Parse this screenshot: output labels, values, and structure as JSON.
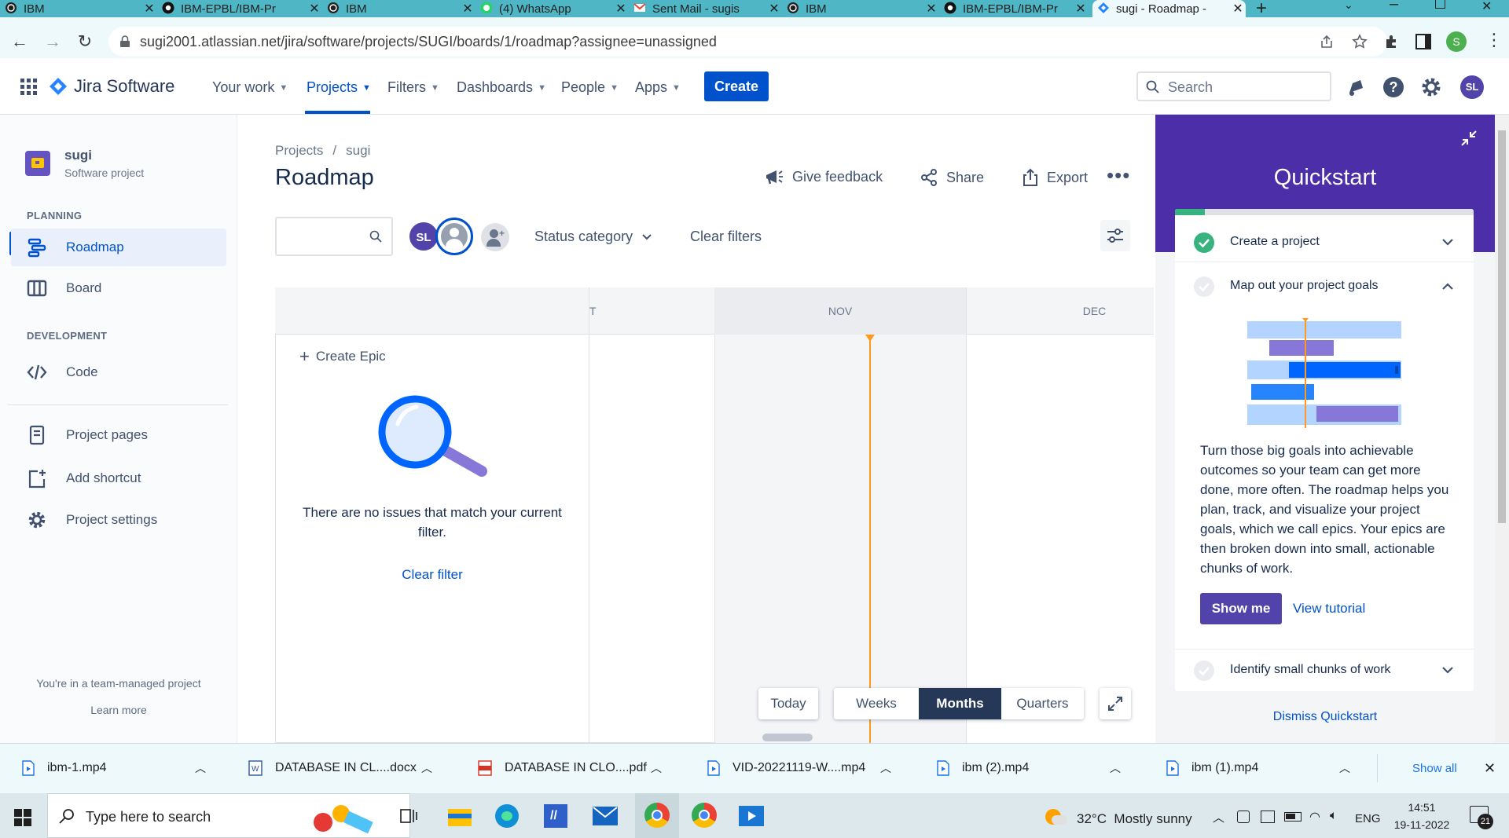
{
  "browser": {
    "tabs": [
      {
        "label": "IBM",
        "icon": "globe-icon"
      },
      {
        "label": "IBM-EPBL/IBM-Pr",
        "icon": "github-icon"
      },
      {
        "label": "IBM",
        "icon": "globe-icon"
      },
      {
        "label": "(4) WhatsApp",
        "icon": "whatsapp-icon"
      },
      {
        "label": "Sent Mail - sugis",
        "icon": "gmail-icon"
      },
      {
        "label": "IBM",
        "icon": "globe-icon"
      },
      {
        "label": "IBM-EPBL/IBM-Pr",
        "icon": "github-icon"
      },
      {
        "label": "sugi - Roadmap -",
        "icon": "jira-icon"
      }
    ],
    "url": "sugi2001.atlassian.net/jira/software/projects/SUGI/boards/1/roadmap?assignee=unassigned",
    "profile_initial": "S"
  },
  "header": {
    "product": "Jira Software",
    "nav": [
      "Your work",
      "Projects",
      "Filters",
      "Dashboards",
      "People",
      "Apps"
    ],
    "create_label": "Create",
    "search_placeholder": "Search",
    "avatar_initials": "SL"
  },
  "sidebar": {
    "project_name": "sugi",
    "project_type": "Software project",
    "planning_heading": "PLANNING",
    "development_heading": "DEVELOPMENT",
    "items": {
      "roadmap": "Roadmap",
      "board": "Board",
      "code": "Code",
      "project_pages": "Project pages",
      "add_shortcut": "Add shortcut",
      "project_settings": "Project settings"
    },
    "footer_text": "You're in a team-managed project",
    "learn_more": "Learn more"
  },
  "main": {
    "breadcrumb": {
      "projects": "Projects",
      "separator": "/",
      "project": "sugi"
    },
    "title": "Roadmap",
    "actions": {
      "feedback": "Give feedback",
      "share": "Share",
      "export": "Export"
    },
    "filter": {
      "avatar_initials": "SL",
      "status_category": "Status category",
      "clear_filters": "Clear filters"
    },
    "timeline": {
      "months": [
        "T",
        "NOV",
        "DEC"
      ],
      "create_epic": "Create Epic",
      "empty_message": "There are no issues that match your current filter.",
      "clear_filter": "Clear filter",
      "controls": {
        "today": "Today",
        "weeks": "Weeks",
        "months": "Months",
        "quarters": "Quarters",
        "selected": "Months"
      }
    }
  },
  "quickstart": {
    "title": "Quickstart",
    "progress": 0.1,
    "steps": [
      {
        "label": "Create a project",
        "done": true
      },
      {
        "label": "Map out your project goals",
        "done": false,
        "expanded": true
      },
      {
        "label": "Identify small chunks of work",
        "done": false
      }
    ],
    "description": "Turn those big goals into achievable outcomes so your team can get more done, more often. The roadmap helps you plan, track, and visualize your project goals, which we call epics. Your epics are then broken down into small, actionable chunks of work.",
    "show_me": "Show me",
    "view_tutorial": "View tutorial",
    "dismiss": "Dismiss Quickstart"
  },
  "downloads": {
    "items": [
      "ibm-1.mp4",
      "DATABASE IN CL....docx",
      "DATABASE IN CLO....pdf",
      "VID-20221119-W....mp4",
      "ibm (2).mp4",
      "ibm (1).mp4"
    ],
    "show_all": "Show all"
  },
  "taskbar": {
    "search_placeholder": "Type here to search",
    "weather": "32°C  Mostly sunny",
    "language": "ENG",
    "time": "14:51",
    "date": "19-11-2022",
    "notifications": "21"
  },
  "colors": {
    "accent": "#0052cc",
    "quickstart_purple": "#4c2ea8",
    "today_line": "#ff991f",
    "tabbar": "#4fb6c6"
  }
}
